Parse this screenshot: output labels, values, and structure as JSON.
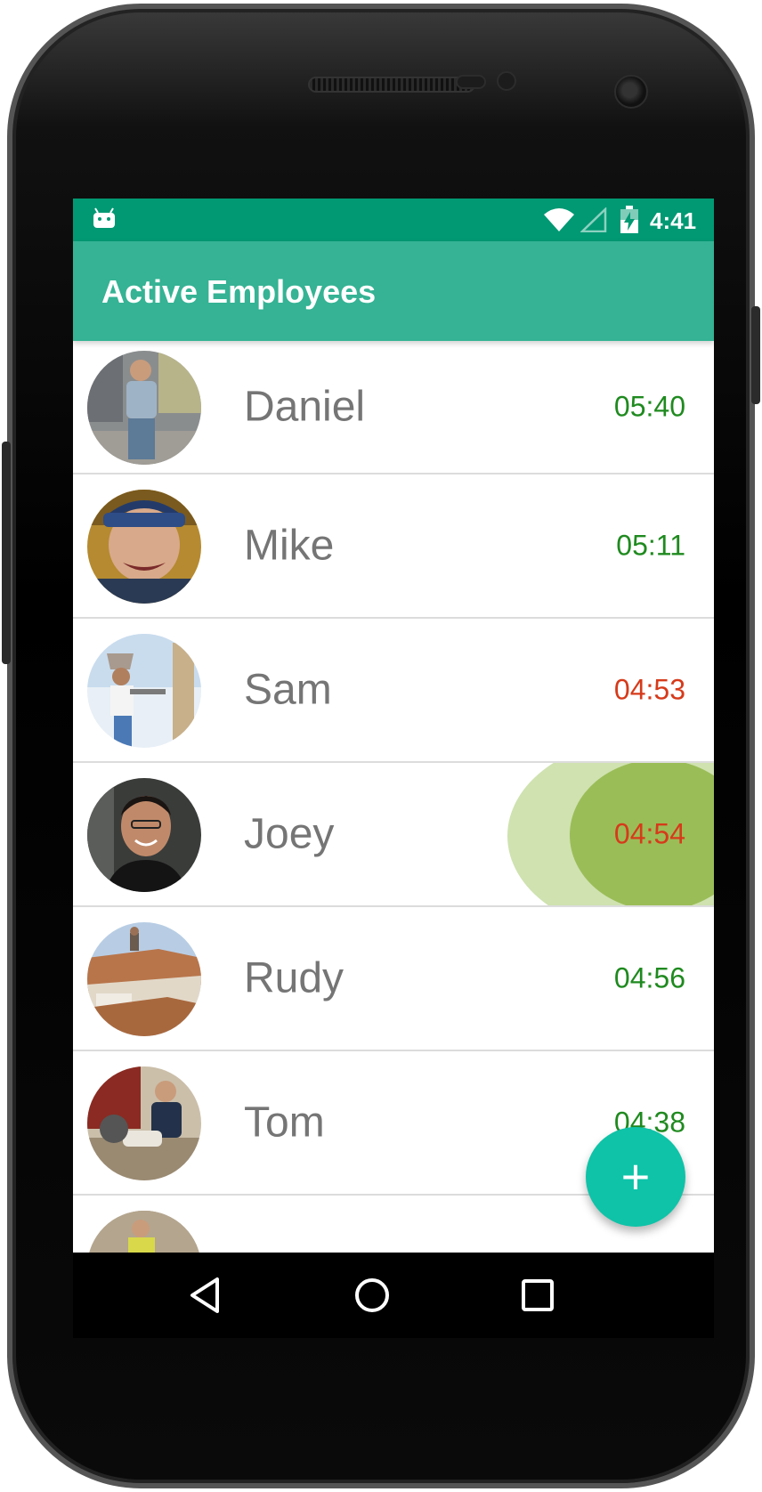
{
  "status_bar": {
    "time": "4:41",
    "color": "#009973"
  },
  "app_bar": {
    "title": "Active Employees",
    "color": "#35b394"
  },
  "employees": [
    {
      "name": "Daniel",
      "time": "05:40",
      "time_color": "#1f8a1f"
    },
    {
      "name": "Mike",
      "time": "05:11",
      "time_color": "#1f8a1f"
    },
    {
      "name": "Sam",
      "time": "04:53",
      "time_color": "#d63a1a"
    },
    {
      "name": "Joey",
      "time": "04:54",
      "time_color": "#d63a1a"
    },
    {
      "name": "Rudy",
      "time": "04:56",
      "time_color": "#1f8a1f"
    },
    {
      "name": "Tom",
      "time": "04:38",
      "time_color": "#1f8a1f"
    },
    {
      "name": "",
      "time": ""
    }
  ],
  "fab": {
    "label": "+",
    "color": "#0ec3a8"
  },
  "nav": {
    "back": "back-icon",
    "home": "home-icon",
    "recents": "recents-icon"
  }
}
